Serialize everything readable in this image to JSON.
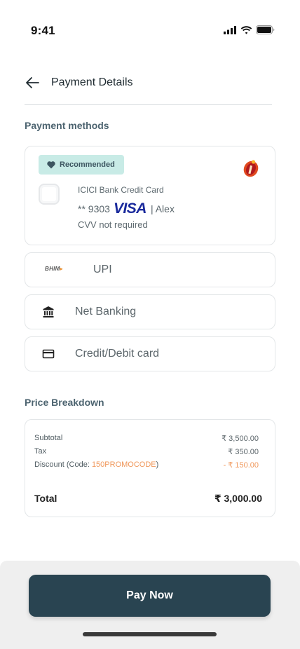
{
  "status_bar": {
    "time": "9:41"
  },
  "header": {
    "title": "Payment Details"
  },
  "payment_methods": {
    "section_title": "Payment methods",
    "recommended_card": {
      "badge": "Recommended",
      "bank_name": "ICICI Bank Credit Card",
      "masked_number": "** 9303",
      "network": "VISA",
      "holder": "| Alex",
      "cvv_note": "CVV not required"
    },
    "upi": {
      "logo_text": "BHIM",
      "label": "UPI"
    },
    "net_banking": {
      "label": "Net Banking"
    },
    "card": {
      "label": "Credit/Debit card"
    }
  },
  "price_breakdown": {
    "section_title": "Price Breakdown",
    "subtotal_label": "Subtotal",
    "subtotal_value": "₹ 3,500.00",
    "tax_label": "Tax",
    "tax_value": "₹ 350.00",
    "discount_label_prefix": "Discount (Code: ",
    "discount_code": "150PROMOCODE",
    "discount_label_suffix": ")",
    "discount_value": "- ₹ 150.00",
    "total_label": "Total",
    "total_value": "₹ 3,000.00"
  },
  "footer": {
    "pay_button": "Pay Now"
  },
  "colors": {
    "primary": "#294451",
    "badge_bg": "#c8ebe6",
    "promo": "#f0975a",
    "visa": "#1a2a9c"
  }
}
